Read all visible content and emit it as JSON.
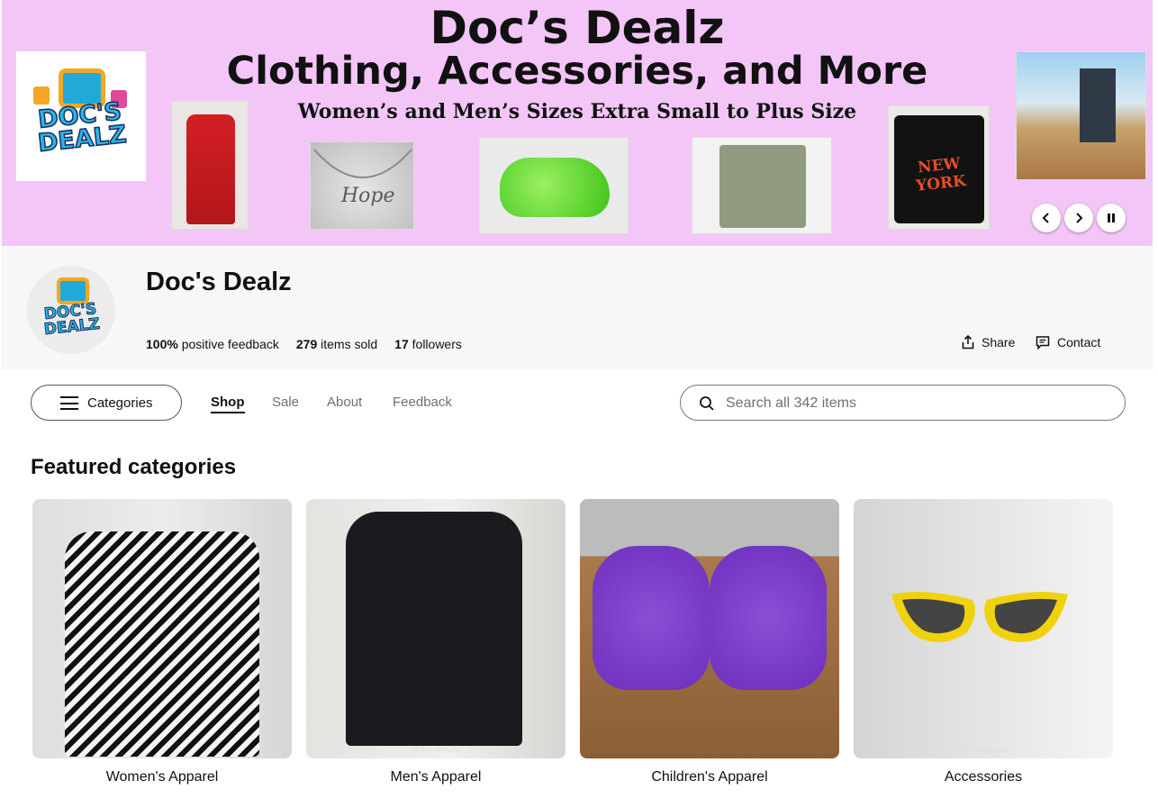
{
  "banner": {
    "title": "Doc’s Dealz",
    "subtitle": "Clothing, Accessories, and More",
    "tagline": "Women’s and Men’s Sizes Extra Small to Plus Size",
    "logo_text": "DOC'S DEALZ",
    "tee_text": "NEW YORK",
    "controls": {
      "prev": "‹",
      "next": "›",
      "pause": "❚❚"
    }
  },
  "store": {
    "name": "Doc's Dealz",
    "avatar_text": "DOC'S DEALZ",
    "stats": [
      {
        "value": "100%",
        "label": "positive feedback"
      },
      {
        "value": "279",
        "label": "items sold"
      },
      {
        "value": "17",
        "label": "followers"
      }
    ],
    "share_label": "Share",
    "contact_label": "Contact"
  },
  "nav": {
    "categories_label": "Categories",
    "tabs": [
      "Shop",
      "Sale",
      "About",
      "Feedback"
    ],
    "active_tab": "Shop",
    "search_placeholder": "Search all 342 items"
  },
  "featured": {
    "title": "Featured categories",
    "items": [
      {
        "label": "Women's Apparel"
      },
      {
        "label": "Men's Apparel",
        "watermark": "@docsdealz"
      },
      {
        "label": "Children's Apparel"
      },
      {
        "label": "Accessories",
        "watermark": "@docsdealz"
      }
    ]
  }
}
